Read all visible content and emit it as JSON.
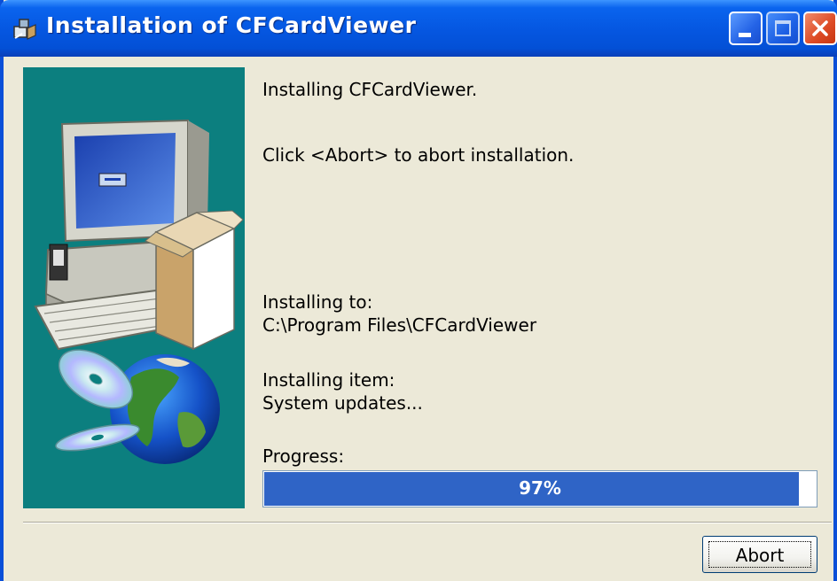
{
  "window": {
    "title": "Installation of CFCardViewer",
    "controls": [
      "minimize-icon",
      "maximize-icon",
      "close-icon"
    ]
  },
  "content": {
    "line1": "Installing CFCardViewer.",
    "line2": "Click <Abort> to abort installation.",
    "install_to_label": "Installing to:",
    "install_to_path": "C:\\Program Files\\CFCardViewer",
    "install_item_label": "Installing item:",
    "install_item_value": "System updates...",
    "progress_label": "Progress:",
    "progress_text": "97%",
    "progress_fraction": 0.97
  },
  "buttons": {
    "abort": "Abort"
  },
  "colors": {
    "titlebar": "#0556e0",
    "art_background": "#0c7f7f",
    "progress_fill": "#2f64c6",
    "dialog_bg": "#ece9d8"
  },
  "icons": {
    "title": "installer-icon",
    "illustration": "computer-and-globe-illustration"
  }
}
